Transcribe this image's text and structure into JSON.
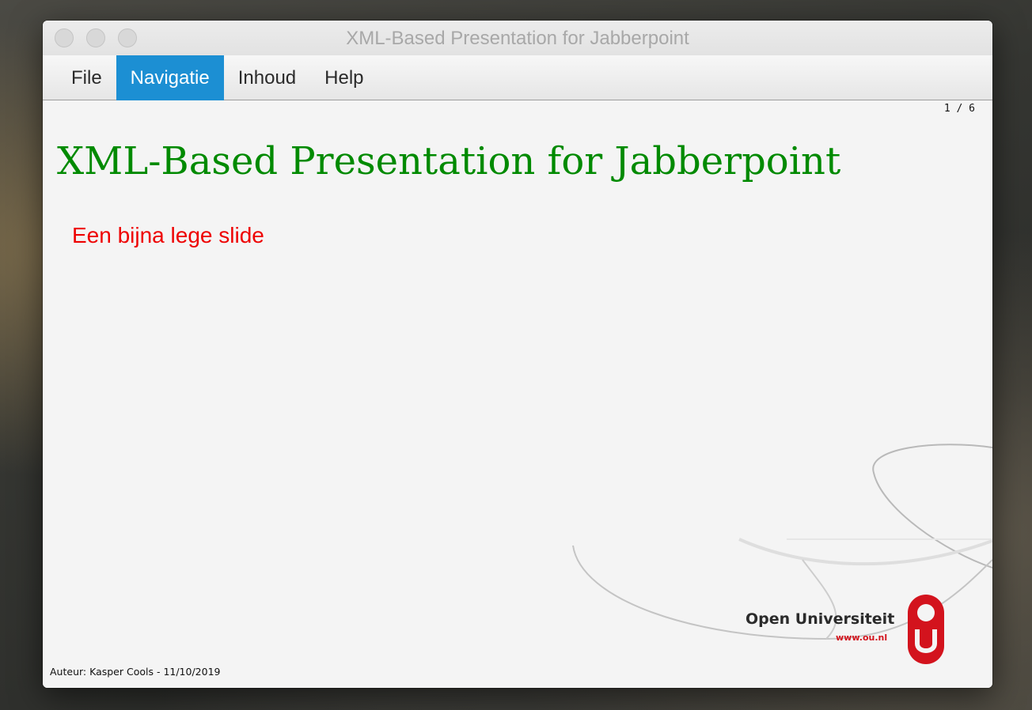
{
  "window": {
    "title": "XML-Based Presentation for Jabberpoint"
  },
  "menubar": {
    "items": [
      {
        "label": "File",
        "active": false
      },
      {
        "label": "Navigatie",
        "active": true
      },
      {
        "label": "Inhoud",
        "active": false
      },
      {
        "label": "Help",
        "active": false
      }
    ],
    "active_color": "#1c8fd3"
  },
  "slide": {
    "counter": "1 / 6",
    "title": "XML-Based Presentation for Jabberpoint",
    "title_color": "#008a00",
    "body": "Een bijna lege slide",
    "body_color": "#ee0000",
    "footer": "Auteur: Kasper Cools - 11/10/2019"
  },
  "logo": {
    "name": "Open Universiteit",
    "url": "www.ou.nl",
    "brand_color": "#d3131d"
  }
}
